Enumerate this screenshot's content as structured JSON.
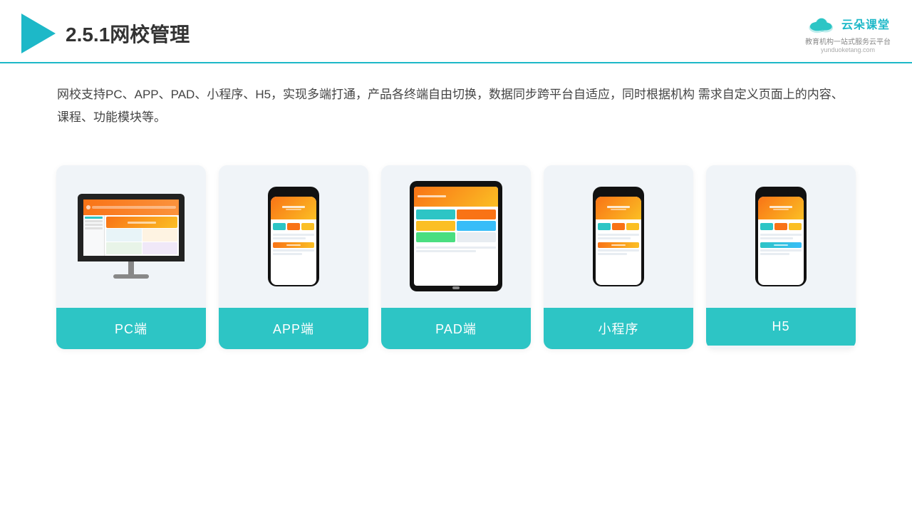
{
  "header": {
    "title": "2.5.1网校管理",
    "brand": {
      "name": "云朵课堂",
      "url": "yunduoketang.com",
      "tagline": "教育机构一站\n式服务云平台"
    }
  },
  "description": "网校支持PC、APP、PAD、小程序、H5，实现多端打通，产品各终端自由切换，数据同步跨平台自适应，同时根据机构\n需求自定义页面上的内容、课程、功能模块等。",
  "cards": [
    {
      "id": "pc",
      "label": "PC端",
      "type": "monitor"
    },
    {
      "id": "app",
      "label": "APP端",
      "type": "phone"
    },
    {
      "id": "pad",
      "label": "PAD端",
      "type": "tablet"
    },
    {
      "id": "miniapp",
      "label": "小程序",
      "type": "phone"
    },
    {
      "id": "h5",
      "label": "H5",
      "type": "phone"
    }
  ],
  "colors": {
    "accent": "#2dc5c5",
    "orange": "#f97316",
    "dark": "#222",
    "text": "#444"
  }
}
